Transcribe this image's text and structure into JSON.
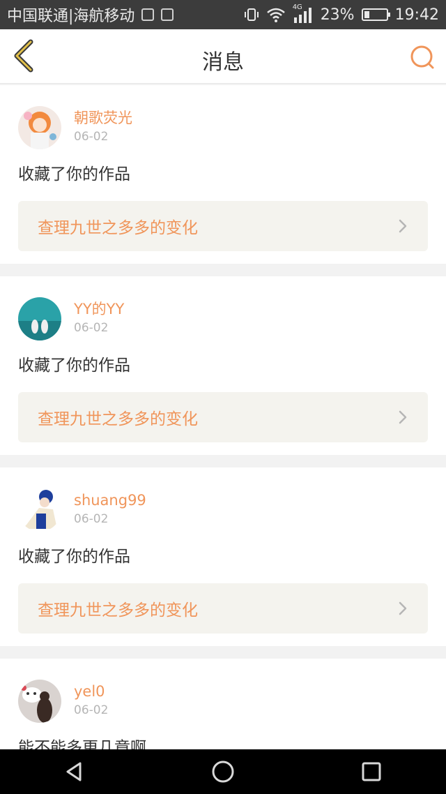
{
  "status_bar": {
    "carrier": "中国联通|海航移动",
    "network": "4G",
    "battery_text": "23%",
    "battery_fraction": 0.23,
    "time": "19:42"
  },
  "header": {
    "title": "消息"
  },
  "messages": [
    {
      "username": "朝歌荧光",
      "date": "06-02",
      "text": "收藏了你的作品",
      "work_title": "查理九世之多多的变化"
    },
    {
      "username": "YY的YY",
      "date": "06-02",
      "text": "收藏了你的作品",
      "work_title": "查理九世之多多的变化"
    },
    {
      "username": "shuang99",
      "date": "06-02",
      "text": "收藏了你的作品",
      "work_title": "查理九世之多多的变化"
    },
    {
      "username": "yel0",
      "date": "06-02",
      "text": "能不能多更几章啊"
    }
  ],
  "colors": {
    "accent": "#f0955a",
    "back_icon": "#e3c14a",
    "link_background": "#f4f3ee"
  },
  "icons": {
    "back": "chevron-left-icon",
    "search": "search-icon",
    "nav_back": "triangle-back-icon",
    "nav_home": "circle-home-icon",
    "nav_recent": "square-recent-icon"
  }
}
